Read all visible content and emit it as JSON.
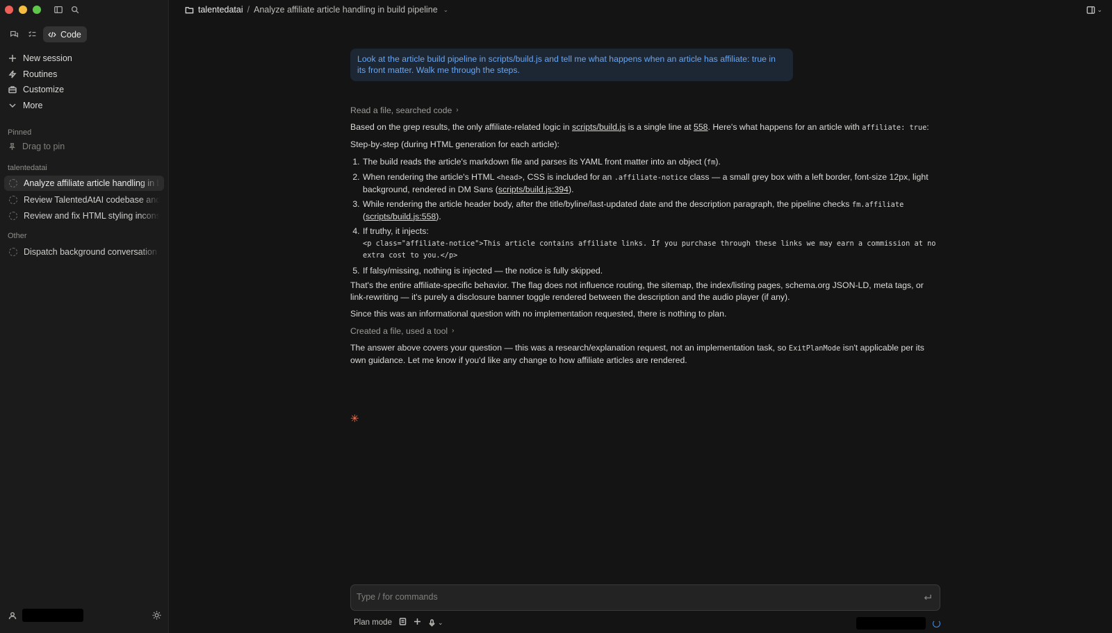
{
  "sidebar": {
    "code_label": "Code",
    "nav": [
      {
        "icon": "plus-icon",
        "label": "New session"
      },
      {
        "icon": "bolt-icon",
        "label": "Routines"
      },
      {
        "icon": "briefcase-icon",
        "label": "Customize"
      },
      {
        "icon": "chevron-down-icon",
        "label": "More"
      }
    ],
    "pinned_label": "Pinned",
    "drag_to_pin": "Drag to pin",
    "project_label": "talentedatai",
    "sessions": [
      {
        "label": "Analyze affiliate article handling in build pipeline",
        "active": true
      },
      {
        "label": "Review TalentedAtAI codebase and build",
        "active": false
      },
      {
        "label": "Review and fix HTML styling inconsistencies",
        "active": false
      }
    ],
    "other_label": "Other",
    "other_sessions": [
      {
        "label": "Dispatch background conversation"
      }
    ]
  },
  "header": {
    "project": "talentedatai",
    "separator": "/",
    "title": "Analyze affiliate article handling in build pipeline"
  },
  "conversation": {
    "user_message": "Look at the article build pipeline in scripts/build.js and tell me what happens when an article has affiliate: true in its front matter. Walk me through the steps.",
    "tool_summary_1": "Read a file, searched code",
    "p1": {
      "a": "Based on the grep results, the only affiliate-related logic in ",
      "link1": "scripts/build.js",
      "b": " is a single line at ",
      "link2": "558",
      "c": ". Here's what happens for an article with ",
      "code": "affiliate: true",
      "d": ":"
    },
    "steps_intro": "Step-by-step (during HTML generation for each article):",
    "step1": {
      "a": "The build reads the article's markdown file and parses its YAML front matter into an object (",
      "code": "fm",
      "b": ")."
    },
    "step2": {
      "a": "When rendering the article's HTML ",
      "code1": "<head>",
      "b": ", CSS is included for an ",
      "code2": ".affiliate-notice",
      "c": " class — a small grey box with a left border, font-size 12px, light background, rendered in DM Sans (",
      "link": "scripts/build.js:394",
      "d": ")."
    },
    "step3": {
      "a": "While rendering the article header body, after the title/byline/last-updated date and the description paragraph, the pipeline checks ",
      "code": "fm.affiliate",
      "b": " (",
      "link": "scripts/build.js:558",
      "c": ")."
    },
    "step4": {
      "a": "If truthy, it injects:",
      "code": "<p class=\"affiliate-notice\">This article contains affiliate links. If you purchase through these links we may earn a commission at no extra cost to you.</p>"
    },
    "step5": "If falsy/missing, nothing is injected — the notice is fully skipped.",
    "p2": "That's the entire affiliate-specific behavior. The flag does not influence routing, the sitemap, the index/listing pages, schema.org JSON-LD, meta tags, or link-rewriting — it's purely a disclosure banner toggle rendered between the description and the audio player (if any).",
    "p3": "Since this was an informational question with no implementation requested, there is nothing to plan.",
    "tool_summary_2": "Created a file, used a tool",
    "p4": {
      "a": "The answer above covers your question — this was a research/explanation request, not an implementation task, so ",
      "code": "ExitPlanMode",
      "b": " isn't applicable per its own guidance. Let me know if you'd like any change to how affiliate articles are rendered."
    },
    "thinking_glyph": "✳"
  },
  "composer": {
    "placeholder": "Type / for commands",
    "mode": "Plan mode"
  },
  "colors": {
    "accent_blue": "#6aa6f0",
    "bubble_bg": "#1d2633",
    "thinking": "#e07a5f"
  }
}
